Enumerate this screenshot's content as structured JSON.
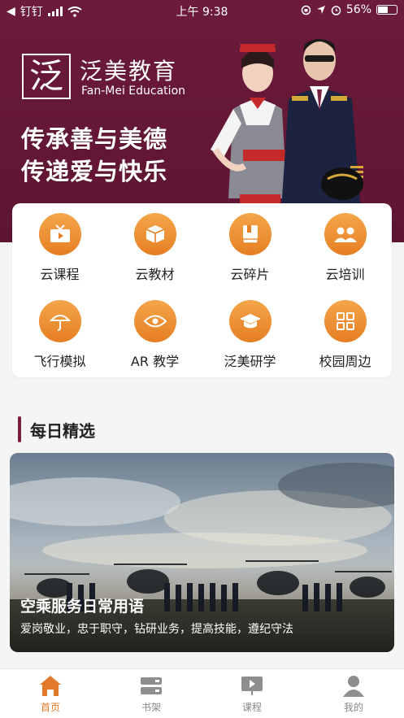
{
  "status_bar": {
    "carrier": "钉钉",
    "time": "上午 9:38",
    "battery": "56%",
    "battery_level": 0.56
  },
  "banner": {
    "logo_char": "泛",
    "logo_caption": "EDUCATION",
    "brand_cn": "泛美教育",
    "brand_en": "Fan-Mei Education",
    "slogan_line1": "传承善与美德",
    "slogan_line2": "传递爱与快乐"
  },
  "features": [
    {
      "label": "云课程",
      "icon": "tv-icon"
    },
    {
      "label": "云教材",
      "icon": "box-icon"
    },
    {
      "label": "云碎片",
      "icon": "book-icon"
    },
    {
      "label": "云培训",
      "icon": "group-icon"
    },
    {
      "label": "飞行模拟",
      "icon": "umbrella-icon"
    },
    {
      "label": "AR 教学",
      "icon": "eye-icon"
    },
    {
      "label": "泛美研学",
      "icon": "graduation-cap-icon"
    },
    {
      "label": "校园周边",
      "icon": "grid-icon"
    }
  ],
  "daily": {
    "section_title": "每日精选",
    "card_title": "空乘服务日常用语",
    "card_subtitle": "爱岗敬业，忠于职守，钻研业务，提高技能，遵纪守法"
  },
  "tabbar": {
    "tabs": [
      {
        "label": "首页",
        "icon": "home-icon",
        "active": true
      },
      {
        "label": "书架",
        "icon": "bookshelf-icon",
        "active": false
      },
      {
        "label": "课程",
        "icon": "course-icon",
        "active": false
      },
      {
        "label": "我的",
        "icon": "profile-icon",
        "active": false
      }
    ]
  },
  "colors": {
    "brand": "#6b1a3a",
    "accent": "#e57f23",
    "active_tab": "#e17a2a"
  }
}
